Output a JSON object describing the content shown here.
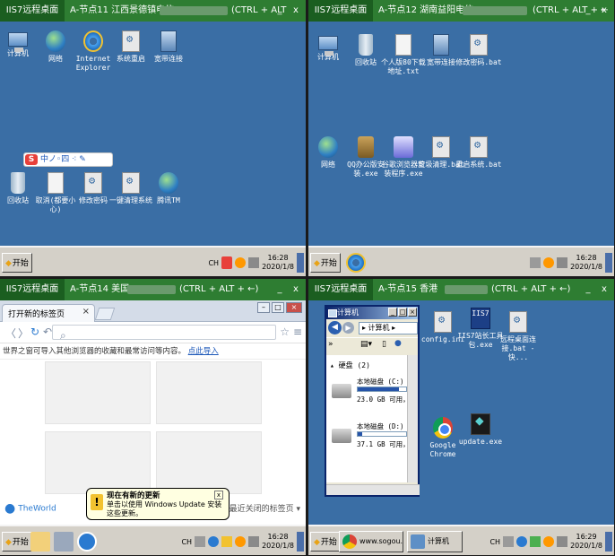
{
  "panels": [
    {
      "title_brand": "IIS7远程桌面",
      "node": "A-节点11  江西景德镇电信",
      "keys": "(CTRL + ALT",
      "controls": [
        "_",
        "x"
      ],
      "icons": [
        {
          "label": "计算机",
          "icon": "computer-icon"
        },
        {
          "label": "网络",
          "icon": "network-icon"
        },
        {
          "label": "Internet Explorer",
          "icon": "ie-icon"
        },
        {
          "label": "系统重启",
          "icon": "bat-file-icon"
        },
        {
          "label": "宽带连接",
          "icon": "broadband-icon"
        },
        {
          "label": "回收站",
          "icon": "recycle-bin-icon"
        },
        {
          "label": "取消(都要小心)",
          "icon": "file-icon"
        },
        {
          "label": "修改密码",
          "icon": "bat-file-icon"
        },
        {
          "label": "一键清理系统",
          "icon": "bat-file-icon"
        },
        {
          "label": "腾讯TM",
          "icon": "tm-icon"
        }
      ],
      "sogou": "中ノ◦四 ⁖ ✎",
      "taskbar": {
        "start": "开始",
        "lang": "CH",
        "time": "16:28",
        "date": "2020/1/8"
      }
    },
    {
      "title_brand": "IIS7远程桌面",
      "node": "A-节点12  湖南益阳电信",
      "keys": "(CTRL + ALT + ←",
      "controls": [
        "_",
        "x"
      ],
      "icons": [
        {
          "label": "计算机",
          "icon": "computer-icon"
        },
        {
          "label": "回收站",
          "icon": "recycle-bin-icon"
        },
        {
          "label": "个人版80下载地址.txt",
          "icon": "text-file-icon"
        },
        {
          "label": "宽带连接",
          "icon": "broadband-icon"
        },
        {
          "label": "修改密码.bat",
          "icon": "bat-file-icon"
        },
        {
          "label": "网络",
          "icon": "network-icon"
        },
        {
          "label": "QQ办公版安装.exe",
          "icon": "qq-installer-icon"
        },
        {
          "label": "谷歌浏览器安装程序.exe",
          "icon": "installer-icon"
        },
        {
          "label": "垃圾清理.bat",
          "icon": "bat-file-icon"
        },
        {
          "label": "重启系统.bat",
          "icon": "bat-file-icon"
        }
      ],
      "taskbar": {
        "start": "开始",
        "time": "16:28",
        "date": "2020/1/8"
      }
    },
    {
      "title_brand": "IIS7远程桌面",
      "node": "A-节点14  美国",
      "keys": "(CTRL + ALT + ←)",
      "controls": [
        "_",
        "x"
      ],
      "browser": {
        "tab_title": "打开新的标签页",
        "info_text": "世界之窗可导入其他浏览器的收藏和最常访问等内容。",
        "info_link": "点此导入",
        "brand": "TheWorld",
        "recent": "最近关闭的标签页 ▾"
      },
      "balloon": {
        "title": "现在有新的更新",
        "text": "单击以使用 Windows Update 安装这些更新。"
      },
      "taskbar": {
        "start": "开始",
        "lang": "CH",
        "time": "16:28",
        "date": "2020/1/8"
      }
    },
    {
      "title_brand": "IIS7远程桌面",
      "node": "A-节点15  香港",
      "keys": "(CTRL + ALT + ←)",
      "controls": [
        "_",
        "x"
      ],
      "explorer": {
        "title": "计算机",
        "path": "▸ 计算机 ▸",
        "section": "硬盘 (2)",
        "drives": [
          {
            "name": "本地磁盘 (C:)",
            "free": "23.0 GB 可用，共",
            "used": 0.85
          },
          {
            "name": "本地磁盘 (D:)",
            "free": "37.1 GB 可用，共",
            "used": 0.1
          }
        ]
      },
      "icons": [
        {
          "label": "config.ini",
          "icon": "config-file-icon"
        },
        {
          "label": "IIS7站长工具包.exe",
          "icon": "iis7-tool-icon"
        },
        {
          "label": "远程桌面连接.bat - 快...",
          "icon": "bat-file-icon"
        },
        {
          "label": "Google Chrome",
          "icon": "chrome-icon"
        },
        {
          "label": "update.exe",
          "icon": "update-icon"
        }
      ],
      "taskbar": {
        "start": "开始",
        "chrome_task": "www.sogou.us ...",
        "explorer_task": "计算机",
        "lang": "CH",
        "time": "16:29",
        "date": "2020/1/8"
      }
    }
  ]
}
